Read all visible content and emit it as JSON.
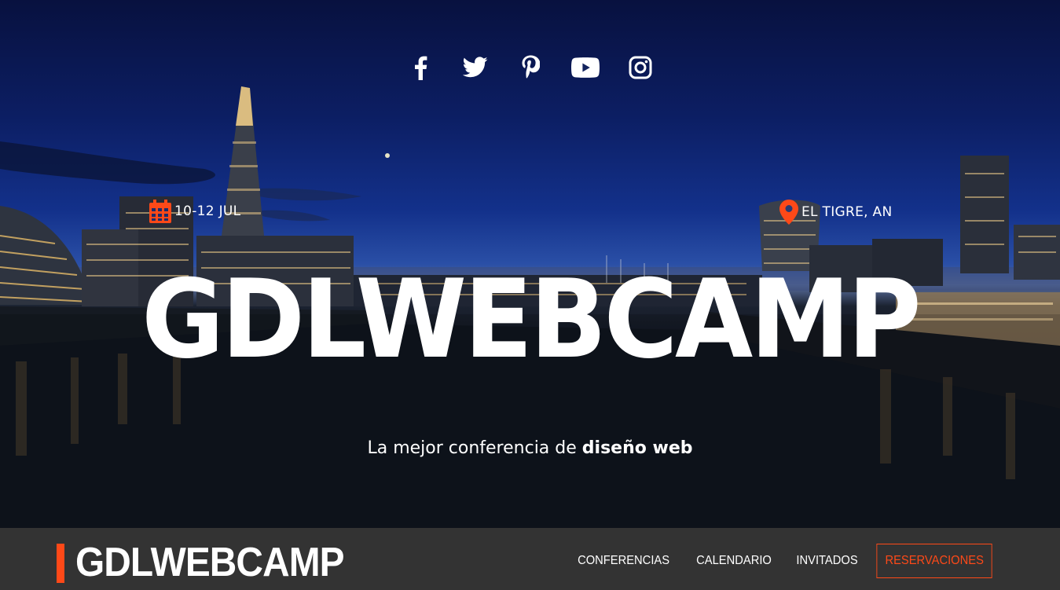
{
  "hero": {
    "social": [
      {
        "name": "facebook-icon"
      },
      {
        "name": "twitter-icon"
      },
      {
        "name": "pinterest-icon"
      },
      {
        "name": "youtube-icon"
      },
      {
        "name": "instagram-icon"
      }
    ],
    "date_text": "10-12 JUL",
    "location_text": "EL TIGRE, AN",
    "title": "GDLWEBCAMP",
    "tagline_prefix": "La mejor conferencia de ",
    "tagline_bold": "diseño web"
  },
  "navbar": {
    "logo_text": "GDLWEBCAMP",
    "items": [
      {
        "label": "CONFERENCIAS"
      },
      {
        "label": "CALENDARIO"
      },
      {
        "label": "INVITADOS"
      },
      {
        "label": "RESERVACIONES"
      }
    ]
  },
  "colors": {
    "accent": "#fe4918",
    "bar_background": "#333333",
    "text": "#ffffff"
  },
  "icons": {
    "date": "calendar-icon",
    "location": "map-marker-icon"
  }
}
